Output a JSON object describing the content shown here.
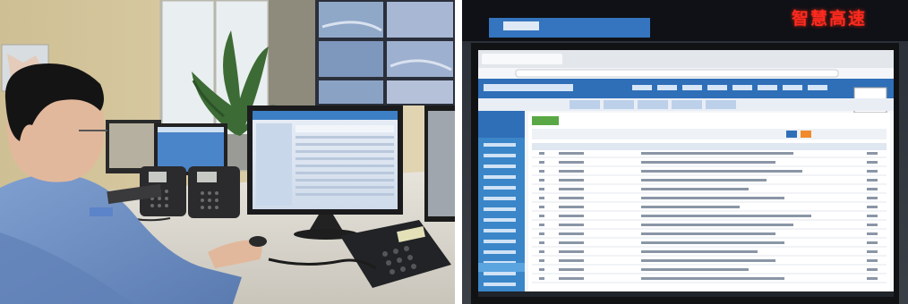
{
  "right_photo": {
    "led_sign_text": "智慧高速"
  },
  "colors": {
    "portal_header": "#2f6fb8",
    "portal_sidebar": "#3a86c8",
    "led_red": "#ff2a1f",
    "shirt_blue": "#6d8fc2"
  }
}
